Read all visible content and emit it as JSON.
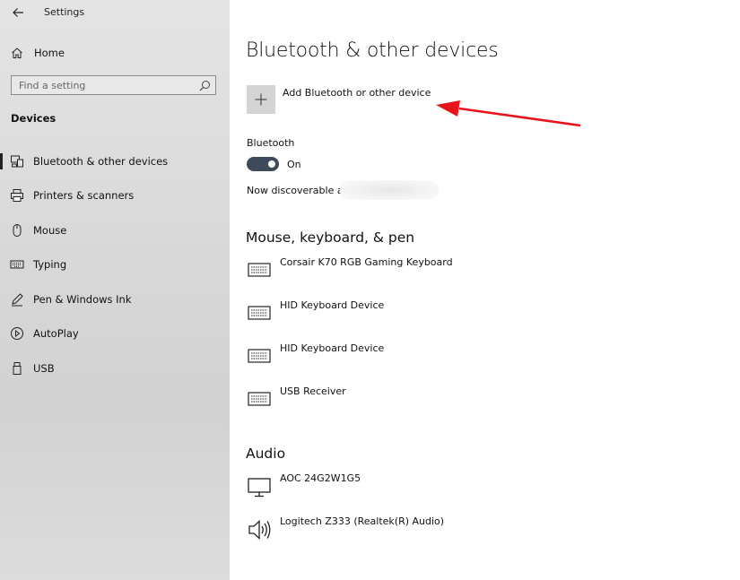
{
  "window": {
    "title": "Settings"
  },
  "sidebar": {
    "home_label": "Home",
    "search_placeholder": "Find a setting",
    "section": "Devices",
    "items": [
      {
        "label": "Bluetooth & other devices",
        "icon": "bluetooth-devices-icon",
        "active": true
      },
      {
        "label": "Printers & scanners",
        "icon": "printer-icon"
      },
      {
        "label": "Mouse",
        "icon": "mouse-icon"
      },
      {
        "label": "Typing",
        "icon": "keyboard-icon"
      },
      {
        "label": "Pen & Windows Ink",
        "icon": "pen-icon"
      },
      {
        "label": "AutoPlay",
        "icon": "autoplay-icon"
      },
      {
        "label": "USB",
        "icon": "usb-icon"
      }
    ]
  },
  "main": {
    "title": "Bluetooth & other devices",
    "add_device_label": "Add Bluetooth or other device",
    "bluetooth_label": "Bluetooth",
    "bluetooth_state": "On",
    "discoverable_label": "Now discoverable as",
    "groups": [
      {
        "title": "Mouse, keyboard, & pen",
        "devices": [
          {
            "name": "Corsair K70 RGB Gaming Keyboard",
            "icon": "keyboard-icon"
          },
          {
            "name": "HID Keyboard Device",
            "icon": "keyboard-icon"
          },
          {
            "name": "HID Keyboard Device",
            "icon": "keyboard-icon"
          },
          {
            "name": "USB Receiver",
            "icon": "keyboard-icon"
          }
        ]
      },
      {
        "title": "Audio",
        "devices": [
          {
            "name": "AOC 24G2W1G5",
            "icon": "monitor-icon"
          },
          {
            "name": "Logitech Z333 (Realtek(R) Audio)",
            "icon": "speaker-icon"
          }
        ]
      }
    ]
  },
  "colors": {
    "accent_annotation": "#e8141b",
    "toggle_on": "#3d4a5a"
  }
}
